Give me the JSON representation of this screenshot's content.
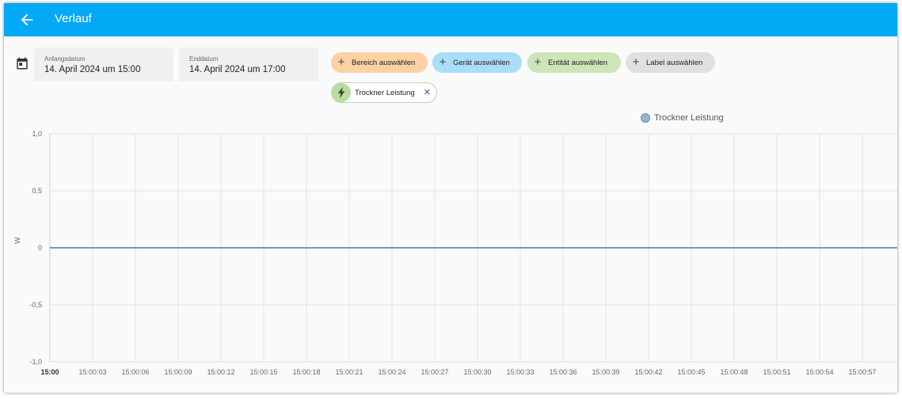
{
  "header": {
    "title": "Verlauf",
    "back_icon": "arrow-left-icon"
  },
  "filters": {
    "start_label": "Anfangsdatum",
    "start_value": "14. April 2024 um 15:00",
    "end_label": "Enddatum",
    "end_value": "14. April 2024 um 17:00",
    "calendar_icon": "calendar-icon"
  },
  "pickers": {
    "area": "Bereich auswählen",
    "device": "Gerät auswählen",
    "entity": "Entität auswählen",
    "label": "Label auswählen"
  },
  "selected_entity": {
    "name": "Trockner Leistung",
    "icon": "flash-icon"
  },
  "colors": {
    "header": "#03a9f4",
    "area_chip": "#fcd1a3",
    "device_chip": "#a8def8",
    "entity_chip": "#cce5b9",
    "label_chip": "#e0e0e0",
    "line": "#4a7aa8"
  },
  "chart_data": {
    "type": "line",
    "ylabel": "W",
    "ylim": [
      -1.0,
      1.0
    ],
    "yticks": [
      "1,0",
      "0,5",
      "0",
      "-0,5",
      "-1,0"
    ],
    "x": [
      "15:00",
      "15:00:03",
      "15:00:06",
      "15:00:09",
      "15:00:12",
      "15:00:15",
      "15:00:18",
      "15:00:21",
      "15:00:24",
      "15:00:27",
      "15:00:30",
      "15:00:33",
      "15:00:36",
      "15:00:39",
      "15:00:42",
      "15:00:45",
      "15:00:48",
      "15:00:51",
      "15:00:54",
      "15:00:57"
    ],
    "series": [
      {
        "name": "Trockner Leistung",
        "values": [
          0,
          0,
          0,
          0,
          0,
          0,
          0,
          0,
          0,
          0,
          0,
          0,
          0,
          0,
          0,
          0,
          0,
          0,
          0,
          0
        ]
      }
    ],
    "legend": "top-right",
    "grid": true
  }
}
